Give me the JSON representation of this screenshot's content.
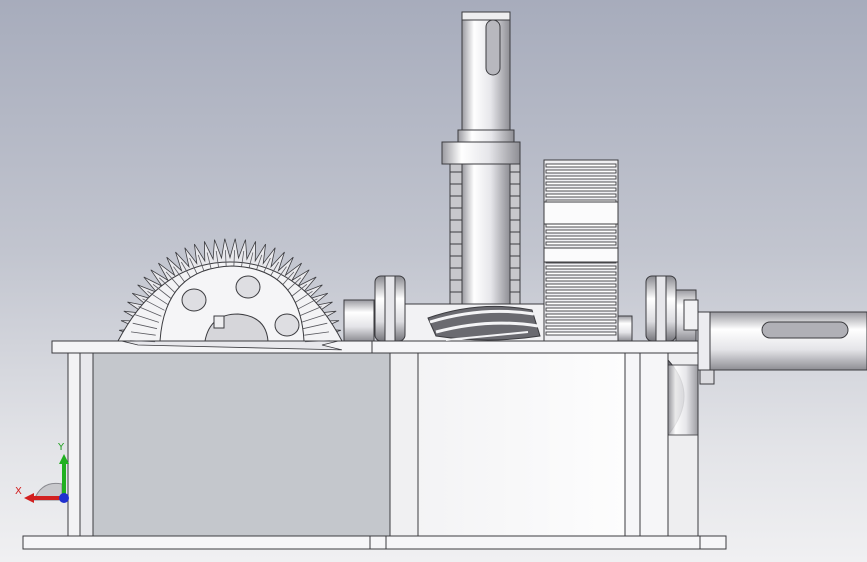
{
  "viewport": {
    "background_top": "#a7acbc",
    "background_bottom": "#f0f0f2"
  },
  "model": {
    "parts": [
      "housing-base-plate",
      "housing-left-block",
      "housing-right-block",
      "bevel-gear",
      "vertical-shaft",
      "spur-gear",
      "worm-gear",
      "output-shaft",
      "bearing-left",
      "bearing-right"
    ],
    "colors": {
      "metal_light": "#f4f4f6",
      "metal_mid": "#d8d8dc",
      "metal_dark": "#8c8c92",
      "housing_shadow": "#c4c7cc",
      "edge": "#3c3c40"
    }
  },
  "triad": {
    "x_label": "X",
    "y_label": "Y",
    "x_color": "#d22020",
    "y_color": "#20b020",
    "z_color": "#2030d0"
  }
}
